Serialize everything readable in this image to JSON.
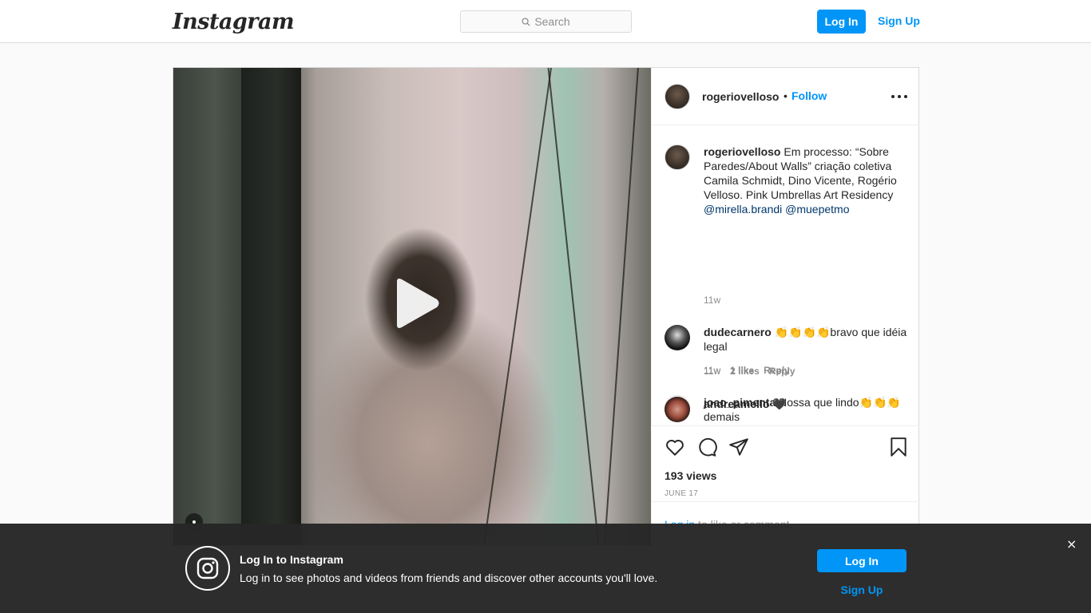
{
  "nav": {
    "logo": "Instagram",
    "search_placeholder": "Search",
    "login_label": "Log In",
    "signup_label": "Sign Up"
  },
  "post": {
    "author": "rogeriovelloso",
    "separator": "•",
    "follow_label": "Follow",
    "caption": {
      "username": "rogeriovelloso",
      "text": "Em processo: “Sobre Paredes/About Walls” criação coletiva Camila Schmidt, Dino Vicente, Rogério Velloso. Pink Umbrellas Art Residency",
      "mention1": "@mirella.brandi",
      "mention2": "@muepetmo",
      "time": "11w"
    },
    "comments": [
      {
        "username": "dudecarnero",
        "text": "👏👏👏👏bravo que idéia legal",
        "time": "11w",
        "likes": "1 like",
        "reply": "Reply"
      },
      {
        "username": "joao_pimenta",
        "text": "Nossa que lindo👏👏👏 demais",
        "time": "11w",
        "likes": "2 likes",
        "reply": "Reply"
      },
      {
        "username": "andreamello",
        "text": "🖤"
      }
    ],
    "views": "193 views",
    "date": "JUNE 17",
    "login_link": "Log in",
    "login_rest": "to like or comment."
  },
  "banner": {
    "title": "Log In to Instagram",
    "subtitle": "Log in to see photos and videos from friends and discover other accounts you'll love.",
    "login_label": "Log In",
    "signup_label": "Sign Up",
    "close": "×"
  },
  "icons": {
    "search": "search-icon",
    "play": "play-icon",
    "more": "more-options-icon",
    "like": "heart-icon",
    "comment": "comment-icon",
    "share": "share-icon",
    "save": "bookmark-icon",
    "instagram": "instagram-icon",
    "close": "close-icon"
  }
}
